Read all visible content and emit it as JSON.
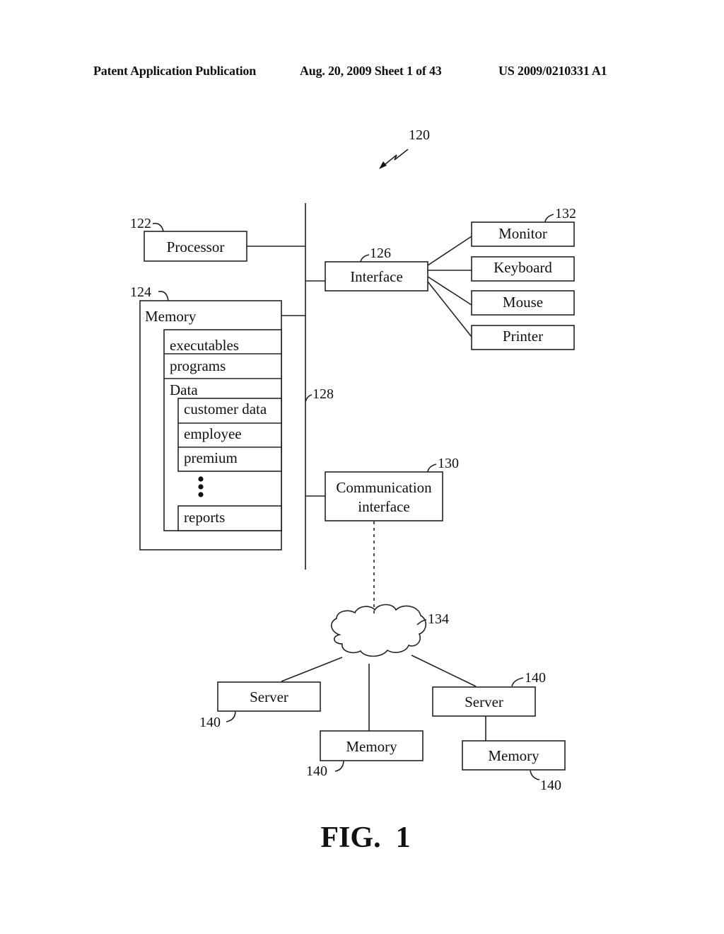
{
  "header": {
    "left": "Patent Application Publication",
    "center": "Aug. 20, 2009  Sheet 1 of 43",
    "right": "US 2009/0210331 A1"
  },
  "diagram": {
    "system_ref": "120",
    "bus_ref": "128",
    "processor": {
      "label": "Processor",
      "ref": "122"
    },
    "memory": {
      "label": "Memory",
      "ref": "124",
      "items": [
        "executables",
        "programs"
      ],
      "data_label": "Data",
      "data_items": [
        "customer data",
        "employee",
        "premium"
      ],
      "last_item": "reports"
    },
    "interface": {
      "label": "Interface",
      "ref": "126"
    },
    "peripherals": {
      "ref": "132",
      "items": [
        "Monitor",
        "Keyboard",
        "Mouse",
        "Printer"
      ]
    },
    "comm_interface": {
      "label_line1": "Communication",
      "label_line2": "interface",
      "ref": "130"
    },
    "network": {
      "ref": "134"
    },
    "remote": {
      "server_left": {
        "label": "Server",
        "ref": "140"
      },
      "memory_mid": {
        "label": "Memory",
        "ref": "140"
      },
      "server_right": {
        "label": "Server",
        "ref": "140"
      },
      "memory_right": {
        "label": "Memory",
        "ref": "140"
      }
    }
  },
  "figure_label": "FIG.  1"
}
